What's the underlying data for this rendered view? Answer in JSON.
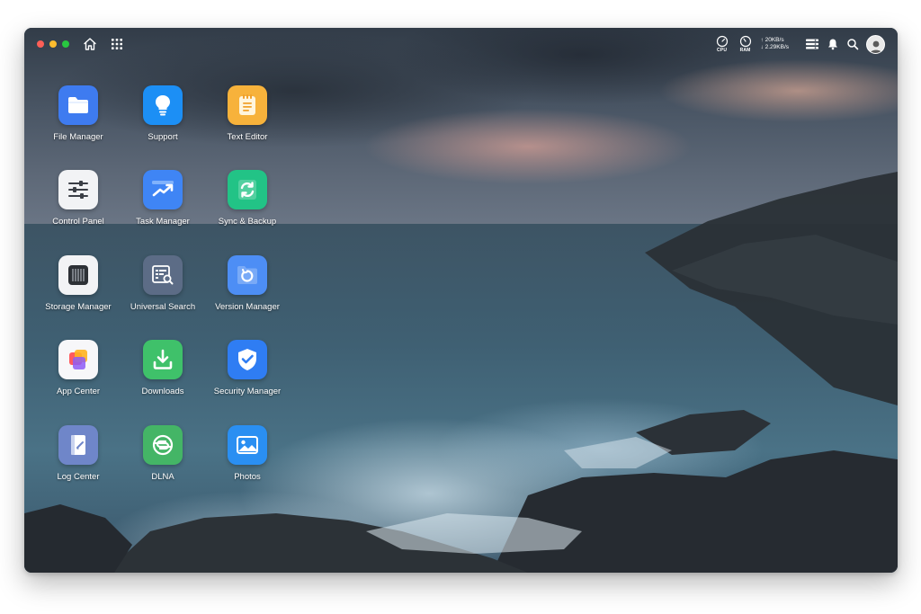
{
  "window": {
    "controls": [
      {
        "name": "close",
        "color": "#ff5f57"
      },
      {
        "name": "minimize",
        "color": "#febc2e"
      },
      {
        "name": "maximize",
        "color": "#28c840"
      }
    ]
  },
  "topbar": {
    "home_icon": "home-icon",
    "apps_icon": "grid-icon",
    "cpu_label": "CPU",
    "ram_label": "RAM",
    "upload_rate": "↑ 20KB/s",
    "download_rate": "↓ 2.29KB/s",
    "widgets_icon": "widgets-icon",
    "notifications_icon": "bell-icon",
    "search_icon": "search-icon",
    "avatar_icon": "avatar"
  },
  "desktop": {
    "apps": [
      {
        "label": "File Manager",
        "icon": "folder-icon",
        "color": "#3e7bf0"
      },
      {
        "label": "Support",
        "icon": "lightbulb-icon",
        "color": "#1c8ff5"
      },
      {
        "label": "Text Editor",
        "icon": "notepad-icon",
        "color": "#f7b23b"
      },
      {
        "label": "Control Panel",
        "icon": "sliders-icon",
        "color": "#f2f3f5"
      },
      {
        "label": "Task Manager",
        "icon": "trend-icon",
        "color": "#3f85f5"
      },
      {
        "label": "Sync & Backup",
        "icon": "sync-icon",
        "color": "#22c386"
      },
      {
        "label": "Storage Manager",
        "icon": "drive-icon",
        "color": "#f2f3f5"
      },
      {
        "label": "Universal Search",
        "icon": "search-doc-icon",
        "color": "#5c6c86"
      },
      {
        "label": "Version Manager",
        "icon": "history-folder-icon",
        "color": "#4d8ef5"
      },
      {
        "label": "App Center",
        "icon": "app-center-icon",
        "color": "#f7f7f9"
      },
      {
        "label": "Downloads",
        "icon": "download-icon",
        "color": "#3fc16a"
      },
      {
        "label": "Security Manager",
        "icon": "shield-check-icon",
        "color": "#2f7df3"
      },
      {
        "label": "Log Center",
        "icon": "log-icon",
        "color": "#6f86c9"
      },
      {
        "label": "DLNA",
        "icon": "dlna-icon",
        "color": "#44b566"
      },
      {
        "label": "Photos",
        "icon": "photo-icon",
        "color": "#2a8ff2"
      }
    ]
  }
}
